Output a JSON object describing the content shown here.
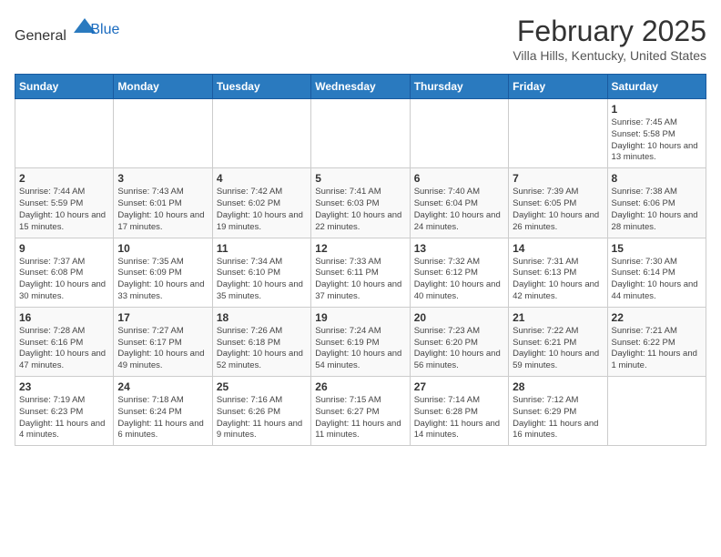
{
  "header": {
    "logo_general": "General",
    "logo_blue": "Blue",
    "month_year": "February 2025",
    "location": "Villa Hills, Kentucky, United States"
  },
  "days_of_week": [
    "Sunday",
    "Monday",
    "Tuesday",
    "Wednesday",
    "Thursday",
    "Friday",
    "Saturday"
  ],
  "weeks": [
    [
      {
        "day": "",
        "info": ""
      },
      {
        "day": "",
        "info": ""
      },
      {
        "day": "",
        "info": ""
      },
      {
        "day": "",
        "info": ""
      },
      {
        "day": "",
        "info": ""
      },
      {
        "day": "",
        "info": ""
      },
      {
        "day": "1",
        "info": "Sunrise: 7:45 AM\nSunset: 5:58 PM\nDaylight: 10 hours and 13 minutes."
      }
    ],
    [
      {
        "day": "2",
        "info": "Sunrise: 7:44 AM\nSunset: 5:59 PM\nDaylight: 10 hours and 15 minutes."
      },
      {
        "day": "3",
        "info": "Sunrise: 7:43 AM\nSunset: 6:01 PM\nDaylight: 10 hours and 17 minutes."
      },
      {
        "day": "4",
        "info": "Sunrise: 7:42 AM\nSunset: 6:02 PM\nDaylight: 10 hours and 19 minutes."
      },
      {
        "day": "5",
        "info": "Sunrise: 7:41 AM\nSunset: 6:03 PM\nDaylight: 10 hours and 22 minutes."
      },
      {
        "day": "6",
        "info": "Sunrise: 7:40 AM\nSunset: 6:04 PM\nDaylight: 10 hours and 24 minutes."
      },
      {
        "day": "7",
        "info": "Sunrise: 7:39 AM\nSunset: 6:05 PM\nDaylight: 10 hours and 26 minutes."
      },
      {
        "day": "8",
        "info": "Sunrise: 7:38 AM\nSunset: 6:06 PM\nDaylight: 10 hours and 28 minutes."
      }
    ],
    [
      {
        "day": "9",
        "info": "Sunrise: 7:37 AM\nSunset: 6:08 PM\nDaylight: 10 hours and 30 minutes."
      },
      {
        "day": "10",
        "info": "Sunrise: 7:35 AM\nSunset: 6:09 PM\nDaylight: 10 hours and 33 minutes."
      },
      {
        "day": "11",
        "info": "Sunrise: 7:34 AM\nSunset: 6:10 PM\nDaylight: 10 hours and 35 minutes."
      },
      {
        "day": "12",
        "info": "Sunrise: 7:33 AM\nSunset: 6:11 PM\nDaylight: 10 hours and 37 minutes."
      },
      {
        "day": "13",
        "info": "Sunrise: 7:32 AM\nSunset: 6:12 PM\nDaylight: 10 hours and 40 minutes."
      },
      {
        "day": "14",
        "info": "Sunrise: 7:31 AM\nSunset: 6:13 PM\nDaylight: 10 hours and 42 minutes."
      },
      {
        "day": "15",
        "info": "Sunrise: 7:30 AM\nSunset: 6:14 PM\nDaylight: 10 hours and 44 minutes."
      }
    ],
    [
      {
        "day": "16",
        "info": "Sunrise: 7:28 AM\nSunset: 6:16 PM\nDaylight: 10 hours and 47 minutes."
      },
      {
        "day": "17",
        "info": "Sunrise: 7:27 AM\nSunset: 6:17 PM\nDaylight: 10 hours and 49 minutes."
      },
      {
        "day": "18",
        "info": "Sunrise: 7:26 AM\nSunset: 6:18 PM\nDaylight: 10 hours and 52 minutes."
      },
      {
        "day": "19",
        "info": "Sunrise: 7:24 AM\nSunset: 6:19 PM\nDaylight: 10 hours and 54 minutes."
      },
      {
        "day": "20",
        "info": "Sunrise: 7:23 AM\nSunset: 6:20 PM\nDaylight: 10 hours and 56 minutes."
      },
      {
        "day": "21",
        "info": "Sunrise: 7:22 AM\nSunset: 6:21 PM\nDaylight: 10 hours and 59 minutes."
      },
      {
        "day": "22",
        "info": "Sunrise: 7:21 AM\nSunset: 6:22 PM\nDaylight: 11 hours and 1 minute."
      }
    ],
    [
      {
        "day": "23",
        "info": "Sunrise: 7:19 AM\nSunset: 6:23 PM\nDaylight: 11 hours and 4 minutes."
      },
      {
        "day": "24",
        "info": "Sunrise: 7:18 AM\nSunset: 6:24 PM\nDaylight: 11 hours and 6 minutes."
      },
      {
        "day": "25",
        "info": "Sunrise: 7:16 AM\nSunset: 6:26 PM\nDaylight: 11 hours and 9 minutes."
      },
      {
        "day": "26",
        "info": "Sunrise: 7:15 AM\nSunset: 6:27 PM\nDaylight: 11 hours and 11 minutes."
      },
      {
        "day": "27",
        "info": "Sunrise: 7:14 AM\nSunset: 6:28 PM\nDaylight: 11 hours and 14 minutes."
      },
      {
        "day": "28",
        "info": "Sunrise: 7:12 AM\nSunset: 6:29 PM\nDaylight: 11 hours and 16 minutes."
      },
      {
        "day": "",
        "info": ""
      }
    ]
  ]
}
